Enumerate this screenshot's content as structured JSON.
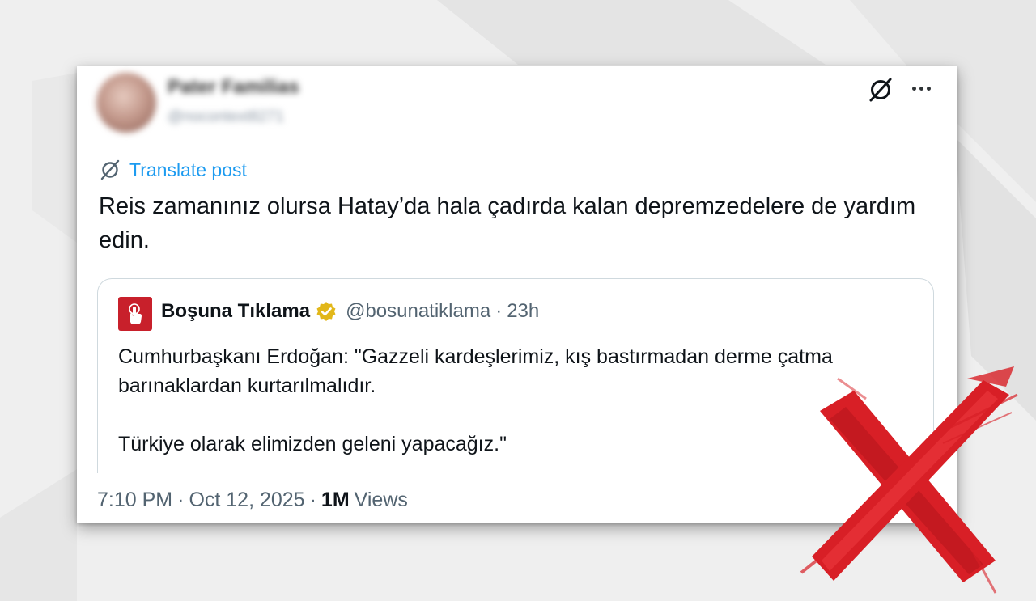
{
  "tweet": {
    "author_name": "Pater Familias",
    "author_handle": "@nocontext8271",
    "translate_label": "Translate post",
    "text": "Reis zamanınız olursa Hatay’da hala çadırda kalan depremzedelere de yardım edin.",
    "time": "7:10 PM",
    "date": "Oct 12, 2025",
    "separator": "·",
    "views_count": "1M",
    "views_label": "Views"
  },
  "quote": {
    "name": "Boşuna Tıklama",
    "handle": "@bosunatiklama",
    "separator": "·",
    "time": "23h",
    "text": "Cumhurbaşkanı Erdoğan: \"Gazzeli kardeşlerimiz, kış bastırmadan derme çatma barınaklardan kurtarılmalıdır.\n\nTürkiye olarak elimizden geleni yapacağız.\""
  },
  "colors": {
    "link_blue": "#1d9bf0",
    "verified_gold": "#e2b719",
    "logo_red": "#c8202b",
    "cross_red": "#d81f26"
  },
  "icons": [
    "translate-icon",
    "more-options-icon",
    "verified-badge-icon",
    "tap-hand-icon",
    "red-cross-mark"
  ]
}
